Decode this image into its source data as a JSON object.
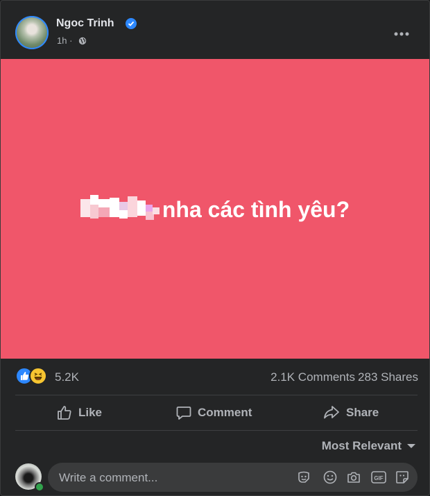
{
  "post": {
    "author": "Ngoc Trinh",
    "verified_icon": "verified-badge-icon",
    "time": "1h ·",
    "privacy_icon": "globe-icon",
    "more_icon": "more-horizontal-icon",
    "background_color": "#f0566a",
    "text": "nha các tình yêu?",
    "censored_hashtag_icon": "pixelated-hashtag"
  },
  "stats": {
    "reaction_icons": [
      "like-reaction-icon",
      "haha-reaction-icon"
    ],
    "reaction_count": "5.2K",
    "comments": "2.1K Comments",
    "shares": "283 Shares"
  },
  "actions": {
    "like": "Like",
    "comment": "Comment",
    "share": "Share"
  },
  "sort": {
    "label": "Most Relevant"
  },
  "composer": {
    "placeholder": "Write a comment...",
    "icons": [
      "sticker-face-icon",
      "emoji-icon",
      "camera-icon",
      "gif-icon",
      "sticker-icon"
    ]
  },
  "colors": {
    "accent": "#2d88ff",
    "card": "#242526",
    "text_secondary": "#b0b3b8",
    "online": "#31a24c"
  }
}
